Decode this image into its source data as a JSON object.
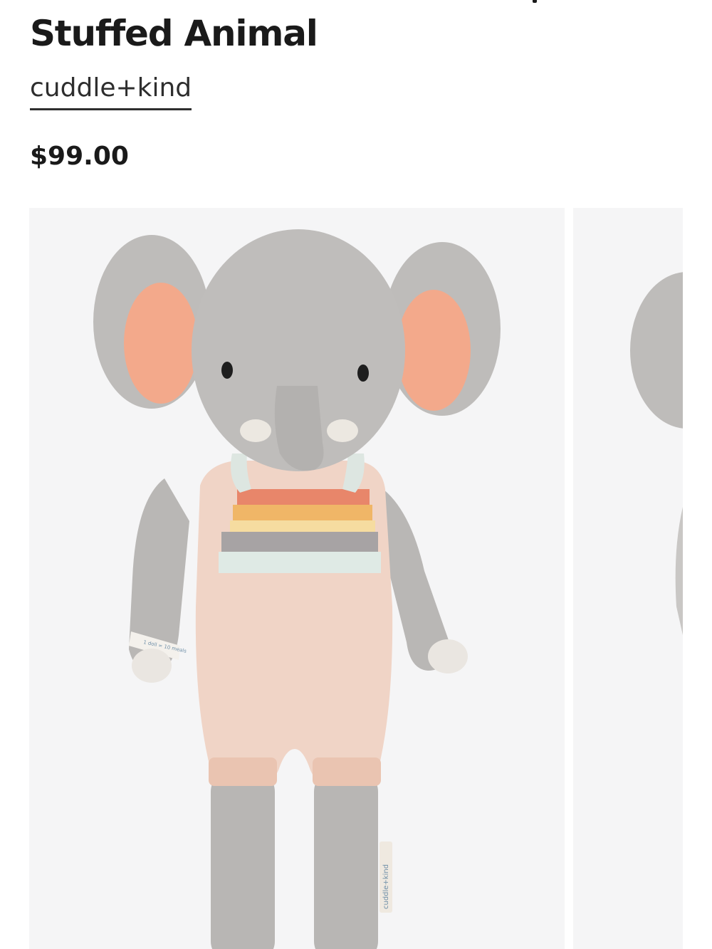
{
  "product": {
    "title": "Stuffed Animal",
    "brand": "cuddle+kind",
    "price": "$99.00"
  },
  "gallery": {
    "images": [
      {
        "subject": "knit gray elephant doll in rainbow-striped romper"
      },
      {
        "subject": "knit gray elephant doll (partial, next slide)"
      }
    ],
    "tag_text": "cuddle+kind",
    "wrist_label_text": "1 doll = 10 meals"
  },
  "colors": {
    "text": "#1a1a1a",
    "image_bg": "#f5f5f6",
    "knit_gray": "#b7b5b3",
    "ear_pink": "#f2a688",
    "romper": "#f1d3c4"
  }
}
